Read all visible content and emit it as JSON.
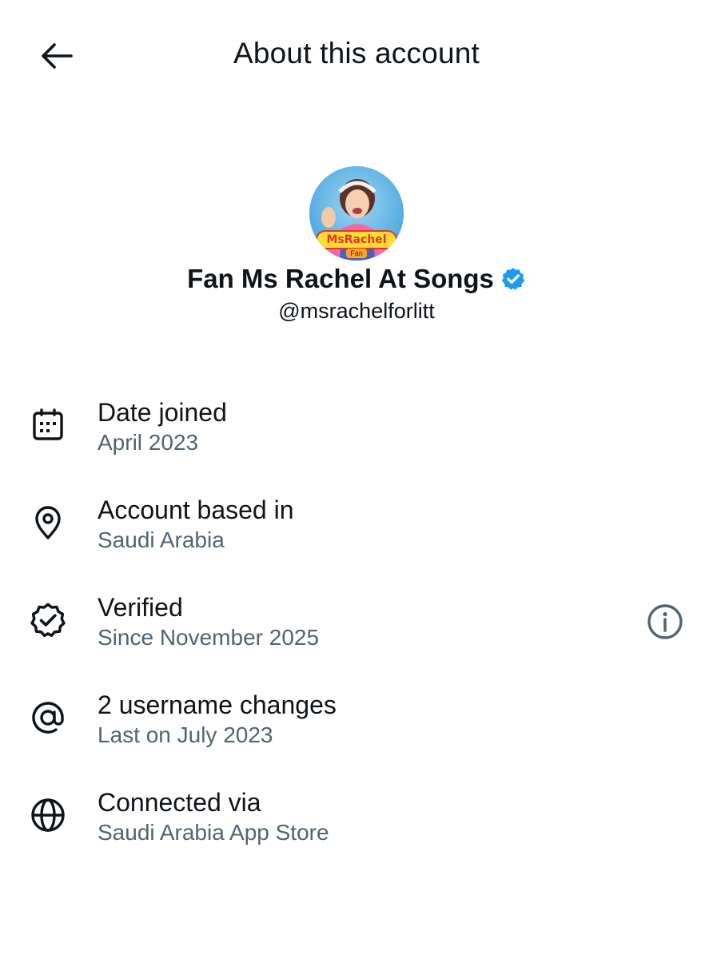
{
  "header": {
    "title": "About this account",
    "back_icon": "arrow-left-icon"
  },
  "profile": {
    "display_name": "Fan Ms Rachel At Songs",
    "handle": "@msrachelforlitt",
    "verified_badge_color": "#1d9bf0",
    "avatar_logo_text": "MsRachel",
    "avatar_logo_sub": "Fan"
  },
  "details": [
    {
      "icon": "calendar-icon",
      "title": "Date joined",
      "subtitle": "April 2023"
    },
    {
      "icon": "location-pin-icon",
      "title": "Account based in",
      "subtitle": "Saudi Arabia"
    },
    {
      "icon": "verified-badge-outline-icon",
      "title": "Verified",
      "subtitle": "Since November 2025",
      "action_icon": "info-icon"
    },
    {
      "icon": "at-sign-icon",
      "title": "2 username changes",
      "subtitle": "Last on July 2023"
    },
    {
      "icon": "globe-icon",
      "title": "Connected via",
      "subtitle": "Saudi Arabia App Store"
    }
  ],
  "colors": {
    "text_primary": "#0f1419",
    "text_secondary": "#536471",
    "accent": "#1d9bf0"
  }
}
